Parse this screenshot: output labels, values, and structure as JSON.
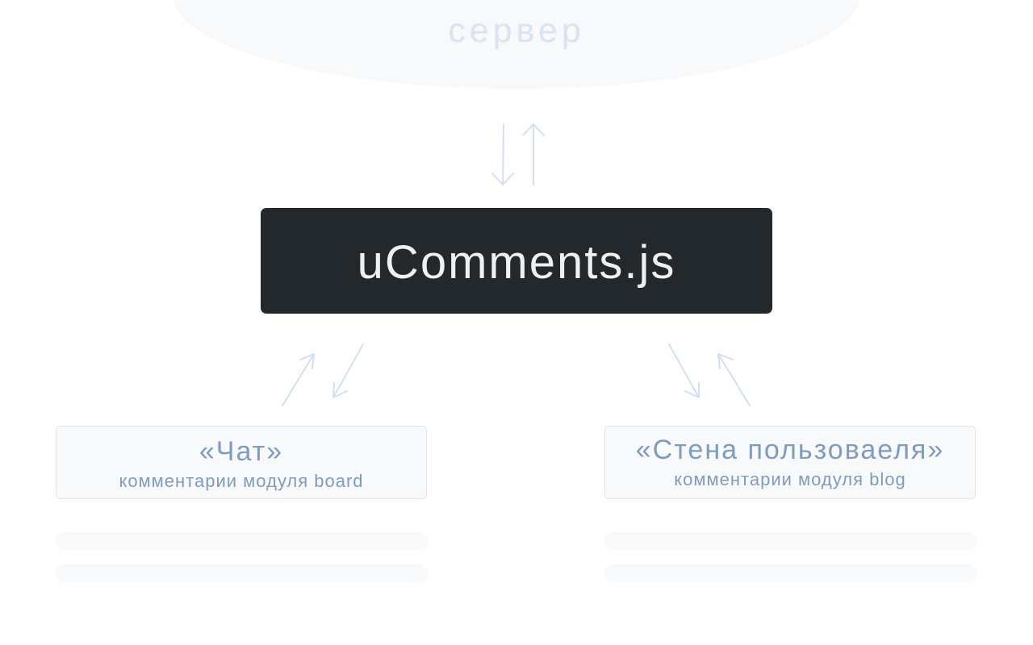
{
  "server": {
    "label": "сервер"
  },
  "core": {
    "title": "uComments.js"
  },
  "modules": [
    {
      "title": "«Чат»",
      "subtitle": "комментарии модуля board"
    },
    {
      "title": "«Стена пользоваеля»",
      "subtitle": "комментарии модуля blog"
    }
  ],
  "colors": {
    "background": "#ffffff",
    "server_fill": "#f8f9fb",
    "server_text": "#dbe3f0",
    "arrow": "#d3dff0",
    "core_fill": "#23282c",
    "core_text": "#eef0f2",
    "module_fill": "#f8f9fb",
    "module_border": "#e1e5eb",
    "module_text": "#7f9bbd"
  }
}
